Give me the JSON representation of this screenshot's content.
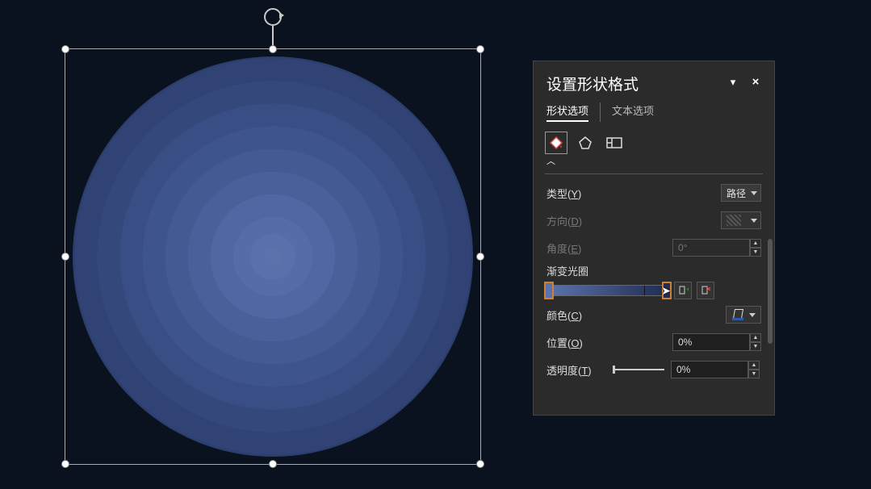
{
  "canvas": {
    "shape": "ellipse",
    "gradient_stops": [
      {
        "pos": 0,
        "color": "#5b73ad"
      },
      {
        "pos": 100,
        "color": "#1f2e52"
      }
    ]
  },
  "panel": {
    "title": "设置形状格式",
    "tabs": {
      "shape": "形状选项",
      "text": "文本选项"
    },
    "icons": {
      "fill": "fill-line-icon",
      "effects": "effects-pentagon-icon",
      "size": "size-layout-icon"
    },
    "rows": {
      "type": {
        "label_pre": "类型(",
        "label_ul": "Y",
        "label_post": ")",
        "value": "路径"
      },
      "direction": {
        "label_pre": "方向(",
        "label_ul": "D",
        "label_post": ")"
      },
      "angle": {
        "label_pre": "角度(",
        "label_ul": "E",
        "label_post": ")",
        "value": "0°"
      },
      "stops": {
        "label": "渐变光圈"
      },
      "color": {
        "label_pre": "颜色(",
        "label_ul": "C",
        "label_post": ")"
      },
      "position": {
        "label_pre": "位置(",
        "label_ul": "O",
        "label_post": ")",
        "value": "0%"
      },
      "transparency": {
        "label_pre": "透明度(",
        "label_ul": "T",
        "label_post": ")",
        "value": "0%"
      }
    }
  },
  "chart_data": {
    "type": "none"
  }
}
